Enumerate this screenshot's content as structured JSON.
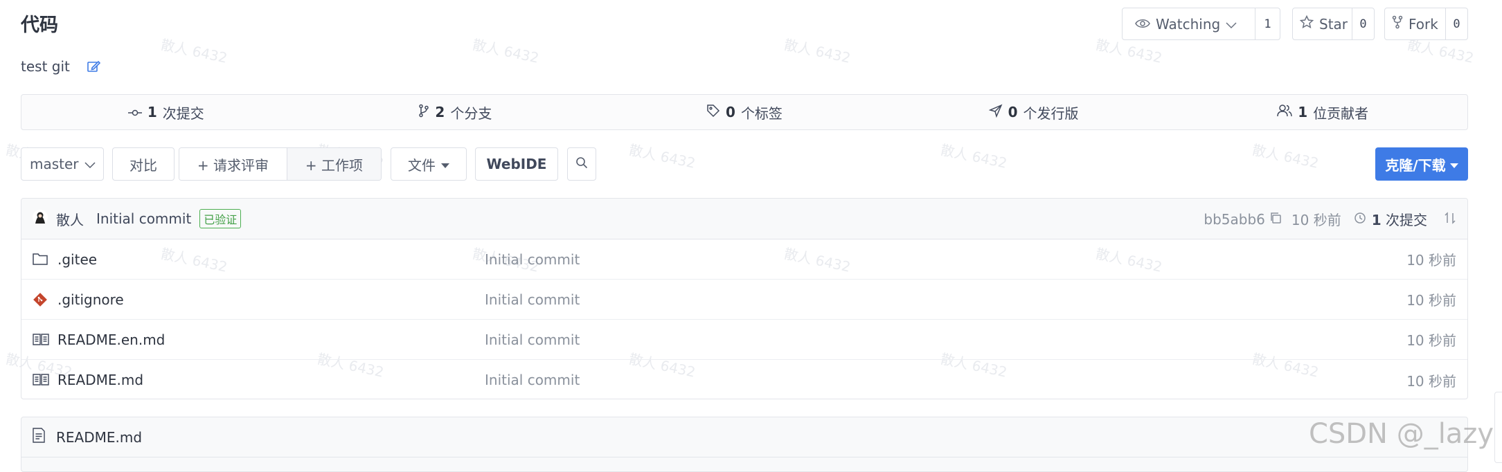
{
  "repo": {
    "title": "代码",
    "description": "test git"
  },
  "header_buttons": {
    "watch_label": "Watching",
    "watch_count": "1",
    "star_label": "Star",
    "star_count": "0",
    "fork_label": "Fork",
    "fork_count": "0"
  },
  "stats": [
    {
      "count": "1",
      "label": "次提交",
      "icon": "commit-icon"
    },
    {
      "count": "2",
      "label": "个分支",
      "icon": "branch-icon"
    },
    {
      "count": "0",
      "label": "个标签",
      "icon": "tag-icon"
    },
    {
      "count": "0",
      "label": "个发行版",
      "icon": "release-icon"
    },
    {
      "count": "1",
      "label": "位贡献者",
      "icon": "contributors-icon"
    }
  ],
  "toolbar": {
    "branch": "master",
    "compare": "对比",
    "pull_request": "+ 请求评审",
    "work_item": "+ 工作项",
    "file": "文件",
    "webide": "WebIDE",
    "clone": "克隆/下载"
  },
  "latest_commit": {
    "author": "散人",
    "message": "Initial commit",
    "verified": "已验证",
    "hash": "bb5abb6",
    "time": "10 秒前",
    "commits_count": "1",
    "commits_label": "次提交"
  },
  "files": [
    {
      "name": ".gitee",
      "type": "folder",
      "message": "Initial commit",
      "time": "10 秒前"
    },
    {
      "name": ".gitignore",
      "type": "git",
      "message": "Initial commit",
      "time": "10 秒前"
    },
    {
      "name": "README.en.md",
      "type": "readme",
      "message": "Initial commit",
      "time": "10 秒前"
    },
    {
      "name": "README.md",
      "type": "readme",
      "message": "Initial commit",
      "time": "10 秒前"
    }
  ],
  "readme_panel": {
    "title": "README.md"
  },
  "watermark": "散人 6432",
  "csdn_watermark": "CSDN @_lazy",
  "colors": {
    "accent": "#3e7be6",
    "verified": "#43a047",
    "git_icon": "#c4452c"
  }
}
